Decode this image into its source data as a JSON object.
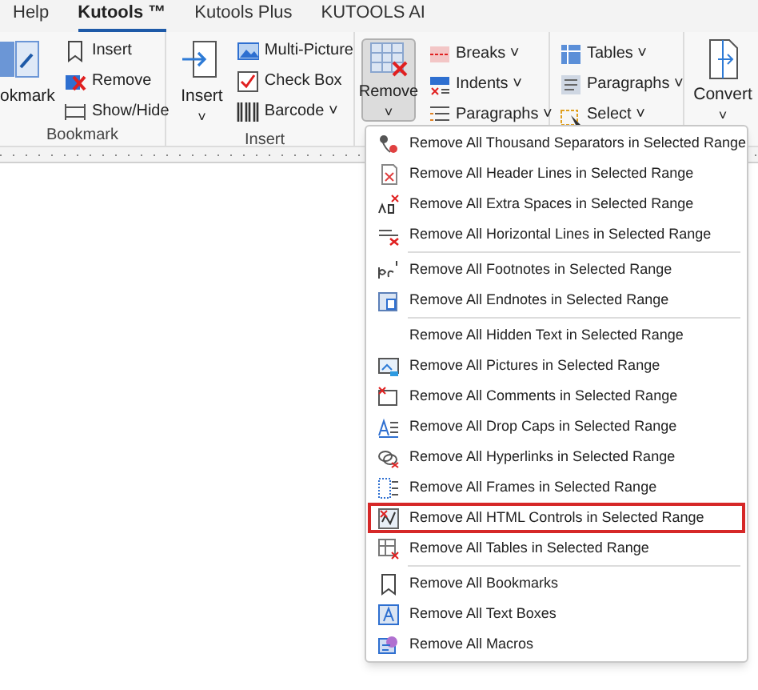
{
  "tabs": [
    {
      "label": "Help",
      "selected": false
    },
    {
      "label": "Kutools ™",
      "selected": true
    },
    {
      "label": "Kutools Plus",
      "selected": false
    },
    {
      "label": "KUTOOLS AI",
      "selected": false
    }
  ],
  "ribbon": {
    "groups": [
      {
        "label": "Bookmark",
        "big": {
          "label": "okmark"
        },
        "small": [
          {
            "label": "Insert"
          },
          {
            "label": "Remove"
          },
          {
            "label": "Show/Hide"
          }
        ]
      },
      {
        "label": "Insert",
        "big": {
          "label": "Insert",
          "caret": "˅"
        },
        "small": [
          {
            "label": "Multi-Picture"
          },
          {
            "label": "Check Box"
          },
          {
            "label": "Barcode ˅"
          }
        ]
      }
    ],
    "remove_button": {
      "label": "Remove",
      "caret": "˅",
      "selected": true
    },
    "column_1": [
      {
        "label": "Breaks ˅"
      },
      {
        "label": "Indents ˅"
      },
      {
        "label": "Paragraphs ˅"
      }
    ],
    "column_2": [
      {
        "label": "Tables ˅"
      },
      {
        "label": "Paragraphs ˅"
      },
      {
        "label": "Select ˅"
      }
    ],
    "convert_button": {
      "label": "Convert",
      "caret": "˅"
    }
  },
  "menu": {
    "sections": [
      [
        {
          "label": "Remove All Thousand Separators in Selected Range",
          "highlighted": false
        },
        {
          "label": "Remove All Header Lines in Selected Range",
          "highlighted": false
        },
        {
          "label": "Remove All Extra Spaces in Selected Range",
          "highlighted": false
        },
        {
          "label": "Remove All Horizontal Lines in Selected Range",
          "highlighted": false
        }
      ],
      [
        {
          "label": "Remove All Footnotes in Selected Range",
          "highlighted": false
        },
        {
          "label": "Remove All Endnotes in Selected Range",
          "highlighted": false
        }
      ],
      [
        {
          "label": "Remove All Hidden Text in Selected Range",
          "highlighted": false
        },
        {
          "label": "Remove All Pictures in Selected Range",
          "highlighted": false
        },
        {
          "label": "Remove All Comments in Selected Range",
          "highlighted": false
        },
        {
          "label": "Remove All Drop Caps in Selected Range",
          "highlighted": false
        },
        {
          "label": "Remove All Hyperlinks in Selected Range",
          "highlighted": false
        },
        {
          "label": "Remove All Frames in Selected Range",
          "highlighted": false
        },
        {
          "label": "Remove All HTML Controls in Selected Range",
          "highlighted": true
        },
        {
          "label": "Remove All Tables in Selected Range",
          "highlighted": false
        }
      ],
      [
        {
          "label": "Remove All Bookmarks",
          "highlighted": false
        },
        {
          "label": "Remove All Text Boxes",
          "highlighted": false
        },
        {
          "label": "Remove All Macros",
          "highlighted": false
        }
      ]
    ]
  }
}
